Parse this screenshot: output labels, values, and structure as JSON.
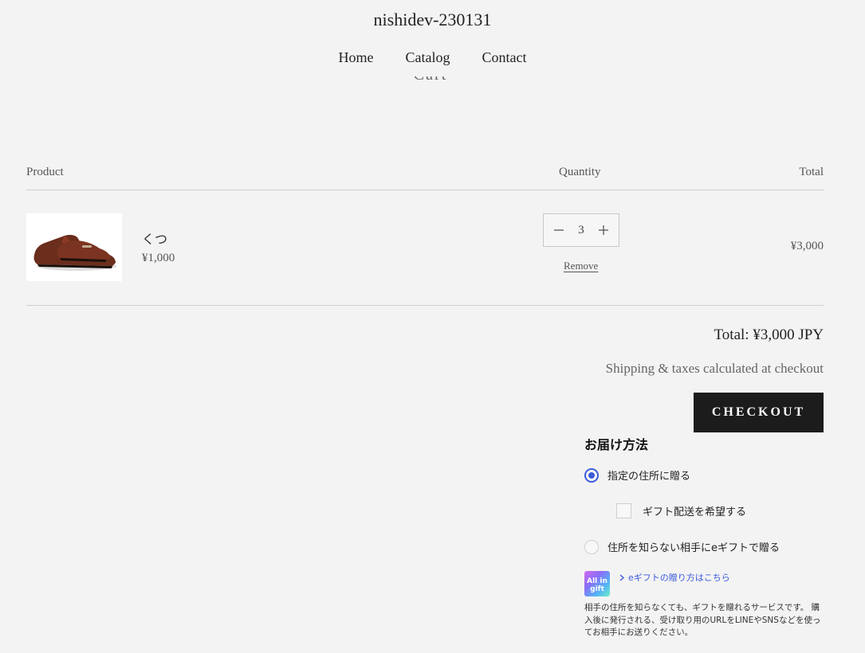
{
  "header": {
    "site_title": "nishidev-230131",
    "nav": [
      "Home",
      "Catalog",
      "Contact"
    ],
    "partial_heading": "Cart"
  },
  "cart": {
    "columns": {
      "product": "Product",
      "quantity": "Quantity",
      "total": "Total"
    },
    "items": [
      {
        "name": "くつ",
        "price": "¥1,000",
        "quantity": "3",
        "remove_label": "Remove",
        "line_total": "¥3,000",
        "image_icon": "brown-monk-shoe-image"
      }
    ],
    "total_label": "Total: ¥3,000 JPY",
    "shipping_note": "Shipping & taxes calculated at checkout",
    "checkout_label": "CHECKOUT"
  },
  "gift": {
    "title": "お届け方法",
    "option_address": "指定の住所に贈る",
    "option_gift_shipping": "ギフト配送を希望する",
    "option_egift": "住所を知らない相手にeギフトで贈る",
    "logo_text": "All in gift",
    "link_label": "eギフトの贈り方はこちら",
    "description": "相手の住所を知らなくても、ギフトを贈れるサービスです。 購入後に発行される、受け取り用のURLをLINEやSNSなどを使ってお相手にお送りください。",
    "accent": "#3b5bdb"
  }
}
